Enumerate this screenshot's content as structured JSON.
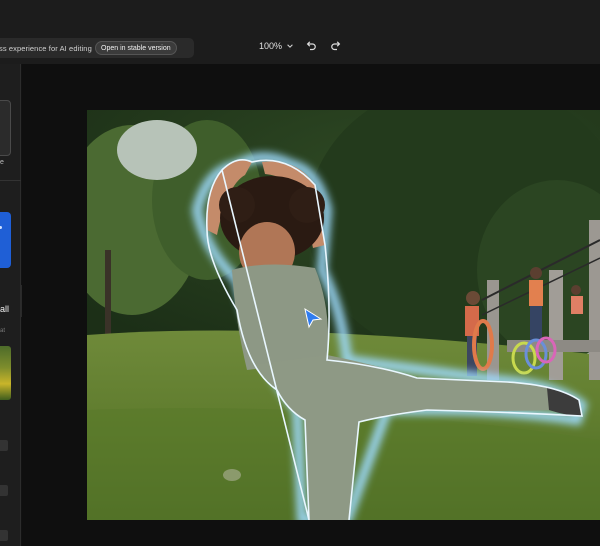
{
  "topbar": {
    "notice_text": "ss experience for AI editing",
    "stable_button_label": "Open in stable version",
    "zoom_level": "100%",
    "undo_icon": "undo-icon",
    "redo_icon": "redo-icon"
  },
  "left_panel": {
    "label_e": "e",
    "label_all": "all",
    "label_small": "at"
  },
  "colors": {
    "accent": "#1f5fd6",
    "cursor": "#2f7cf0",
    "selection_glow": "#8fd3ff"
  }
}
